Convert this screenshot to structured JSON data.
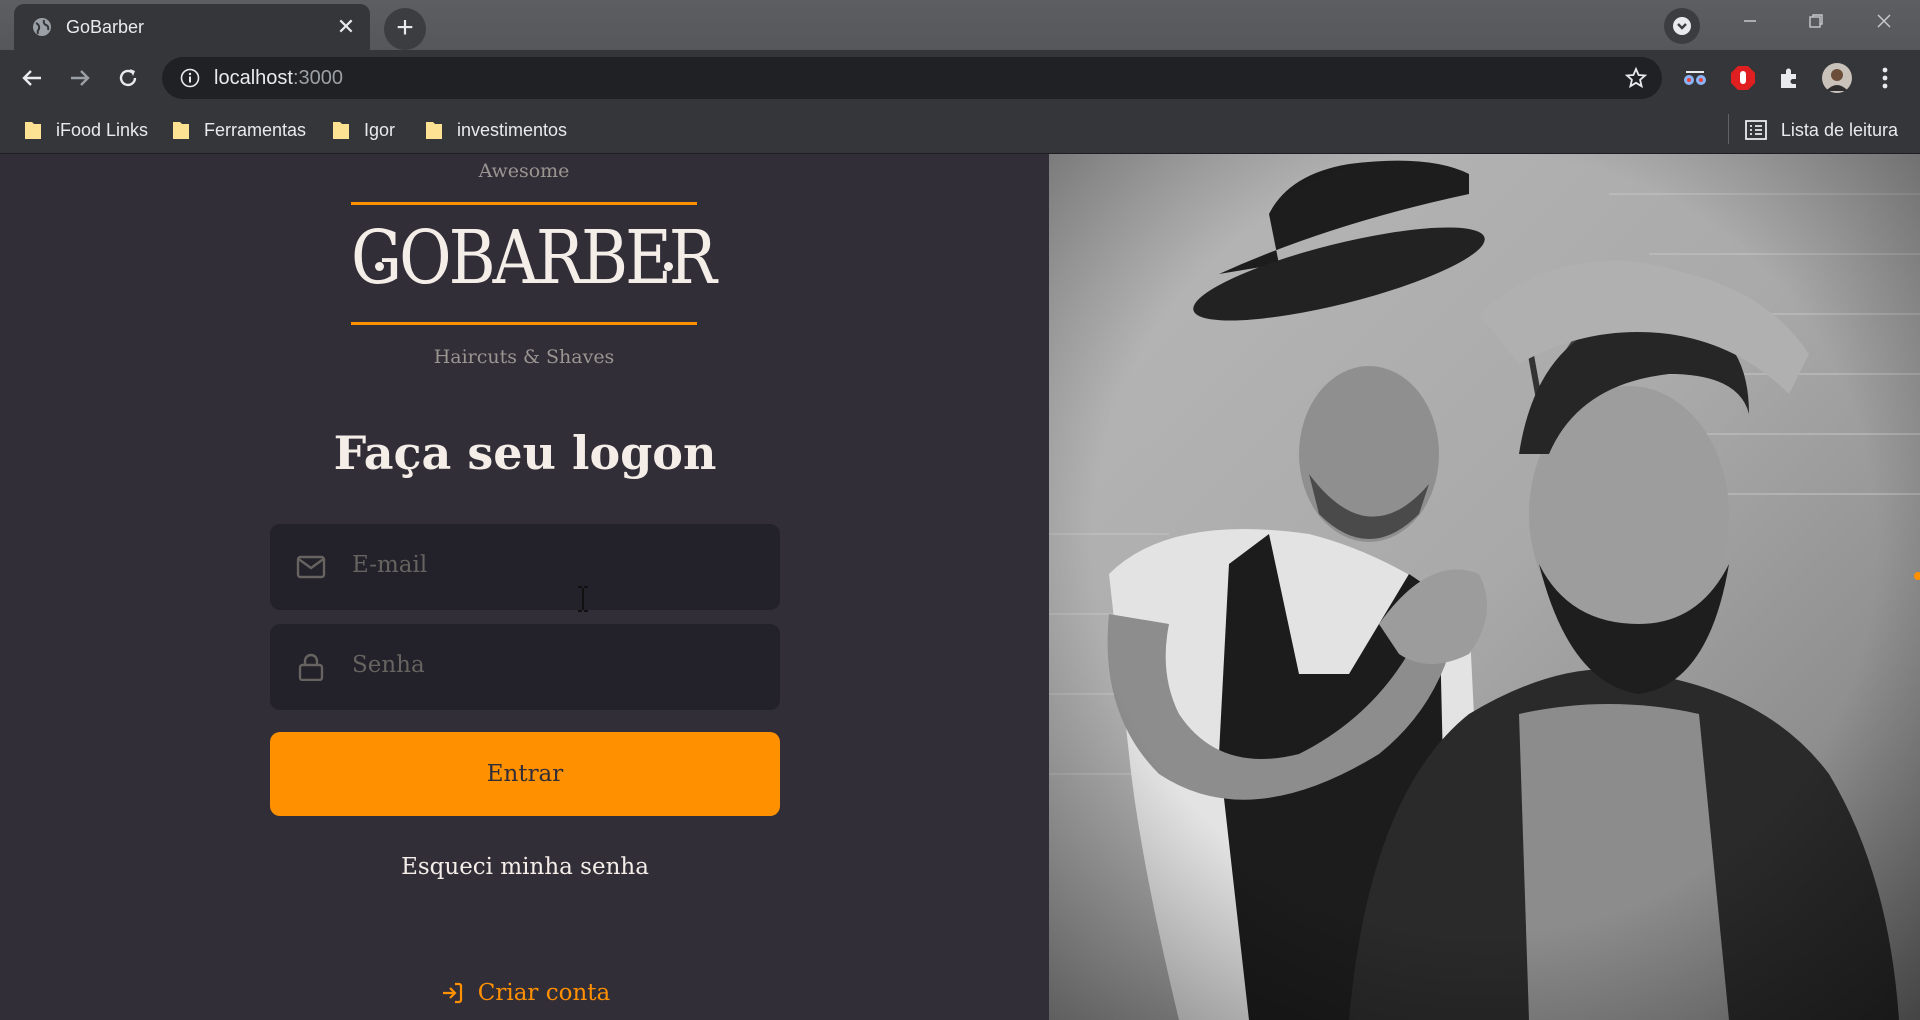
{
  "browser": {
    "tab_title": "GoBarber",
    "tab_close": "✕",
    "new_tab": "+",
    "url_host": "localhost",
    "url_port": ":3000",
    "bookmarks": [
      {
        "label": "iFood Links"
      },
      {
        "label": "Ferramentas"
      },
      {
        "label": "Igor"
      },
      {
        "label": "investimentos"
      }
    ],
    "reading_list": "Lista de leitura"
  },
  "logo": {
    "top_text": "Awesome",
    "main_text": "GOBARBER",
    "bottom_text": "Haircuts & Shaves"
  },
  "form": {
    "title": "Faça seu logon",
    "email_placeholder": "E-mail",
    "password_placeholder": "Senha",
    "submit_label": "Entrar",
    "forgot_label": "Esqueci minha senha",
    "create_account_label": "Criar conta"
  },
  "colors": {
    "background": "#312e38",
    "input_background": "#232129",
    "accent": "#ff9000",
    "text": "#f4ede8",
    "muted": "#666360"
  }
}
